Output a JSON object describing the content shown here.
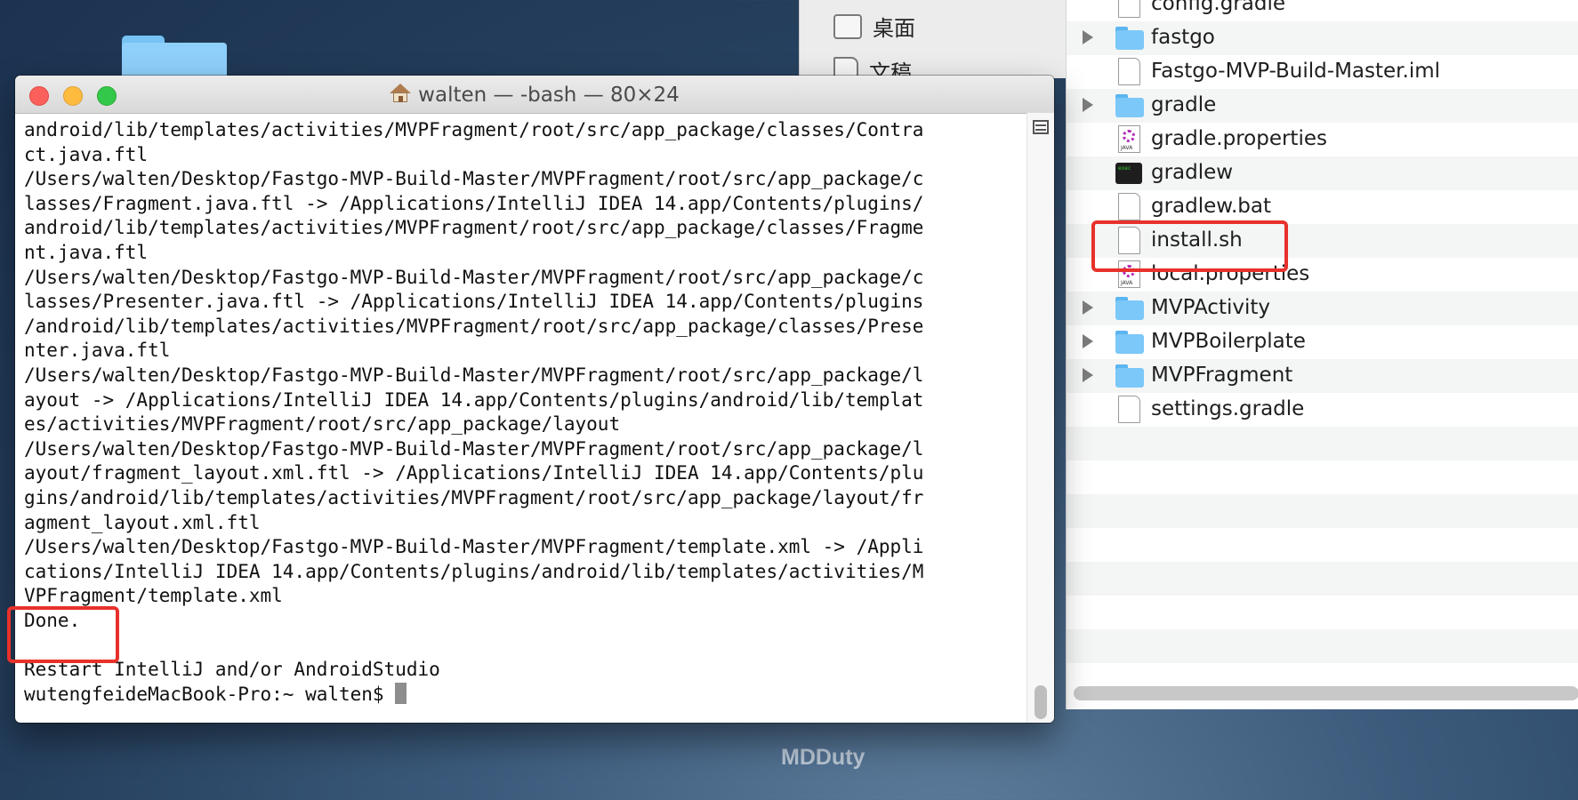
{
  "desktop": {
    "watermark": "MDDuty"
  },
  "finder_sidebar": {
    "items": [
      {
        "label": "桌面",
        "icon": "desktop-icon"
      },
      {
        "label": "文稿",
        "icon": "documents-icon"
      }
    ]
  },
  "finder_files": [
    {
      "name": "config.gradle",
      "type": "document",
      "disclosure": false
    },
    {
      "name": "fastgo",
      "type": "folder",
      "disclosure": true
    },
    {
      "name": "Fastgo-MVP-Build-Master.iml",
      "type": "document",
      "disclosure": false
    },
    {
      "name": "gradle",
      "type": "folder",
      "disclosure": true
    },
    {
      "name": "gradle.properties",
      "type": "java-properties",
      "disclosure": false
    },
    {
      "name": "gradlew",
      "type": "executable",
      "disclosure": false
    },
    {
      "name": "gradlew.bat",
      "type": "document",
      "disclosure": false
    },
    {
      "name": "install.sh",
      "type": "document",
      "disclosure": false,
      "highlighted": true
    },
    {
      "name": "local.properties",
      "type": "java-properties",
      "disclosure": false
    },
    {
      "name": "MVPActivity",
      "type": "folder",
      "disclosure": true
    },
    {
      "name": "MVPBoilerplate",
      "type": "folder",
      "disclosure": true
    },
    {
      "name": "MVPFragment",
      "type": "folder",
      "disclosure": true
    },
    {
      "name": "settings.gradle",
      "type": "document",
      "disclosure": false
    }
  ],
  "terminal": {
    "title": "walten — -bash — 80×24",
    "lines": [
      "android/lib/templates/activities/MVPFragment/root/src/app_package/classes/Contra",
      "ct.java.ftl",
      "/Users/walten/Desktop/Fastgo-MVP-Build-Master/MVPFragment/root/src/app_package/c",
      "lasses/Fragment.java.ftl -> /Applications/IntelliJ IDEA 14.app/Contents/plugins/",
      "android/lib/templates/activities/MVPFragment/root/src/app_package/classes/Fragme",
      "nt.java.ftl",
      "/Users/walten/Desktop/Fastgo-MVP-Build-Master/MVPFragment/root/src/app_package/c",
      "lasses/Presenter.java.ftl -> /Applications/IntelliJ IDEA 14.app/Contents/plugins",
      "/android/lib/templates/activities/MVPFragment/root/src/app_package/classes/Prese",
      "nter.java.ftl",
      "/Users/walten/Desktop/Fastgo-MVP-Build-Master/MVPFragment/root/src/app_package/l",
      "ayout -> /Applications/IntelliJ IDEA 14.app/Contents/plugins/android/lib/templat",
      "es/activities/MVPFragment/root/src/app_package/layout",
      "/Users/walten/Desktop/Fastgo-MVP-Build-Master/MVPFragment/root/src/app_package/l",
      "ayout/fragment_layout.xml.ftl -> /Applications/IntelliJ IDEA 14.app/Contents/plu",
      "gins/android/lib/templates/activities/MVPFragment/root/src/app_package/layout/fr",
      "agment_layout.xml.ftl",
      "/Users/walten/Desktop/Fastgo-MVP-Build-Master/MVPFragment/template.xml -> /Appli",
      "cations/IntelliJ IDEA 14.app/Contents/plugins/android/lib/templates/activities/M",
      "VPFragment/template.xml",
      "Done.",
      "",
      "Restart IntelliJ and/or AndroidStudio",
      "wutengfeideMacBook-Pro:~ walten$ "
    ]
  },
  "annotation_color": "#e8312b"
}
